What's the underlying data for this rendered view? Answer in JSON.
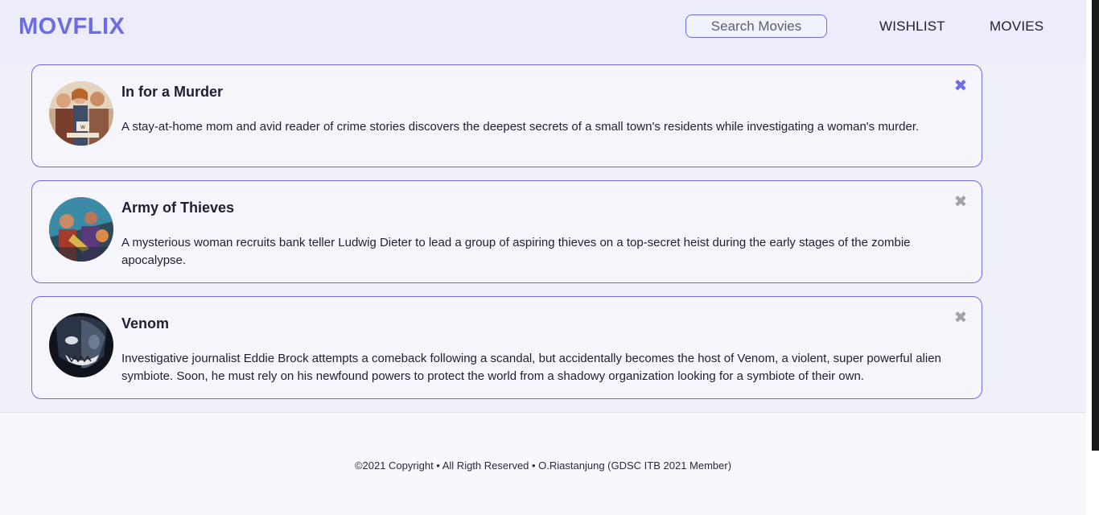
{
  "navbar": {
    "logo": "MOVFLIX",
    "search_placeholder": "Search Movies",
    "links": [
      "WISHLIST",
      "MOVIES"
    ]
  },
  "wishlist": [
    {
      "title": "In for a Murder",
      "description": "A stay-at-home mom and avid reader of crime stories discovers the deepest secrets of a small town's residents while investigating a woman's murder.",
      "remove_icon": "✖",
      "remove_color": "#6d6ce0"
    },
    {
      "title": "Army of Thieves",
      "description": "A mysterious woman recruits bank teller Ludwig Dieter to lead a group of aspiring thieves on a top-secret heist during the early stages of the zombie apocalypse.",
      "remove_icon": "✖",
      "remove_color": "#a3a3ab"
    },
    {
      "title": "Venom",
      "description": "Investigative journalist Eddie Brock attempts a comeback following a scandal, but accidentally becomes the host of Venom, a violent, super powerful alien symbiote. Soon, he must rely on his newfound powers to protect the world from a shadowy organization looking for a symbiote of their own.",
      "remove_icon": "✖",
      "remove_color": "#a3a3ab"
    }
  ],
  "footer": {
    "text": "©2021 Copyright • All Rigth Reserved • O.Riastanjung (GDSC ITB 2021 Member)"
  },
  "colors": {
    "accent": "#6d6ce0",
    "navbar_bg": "#ececfa",
    "content_bg": "#f0f0f9"
  }
}
